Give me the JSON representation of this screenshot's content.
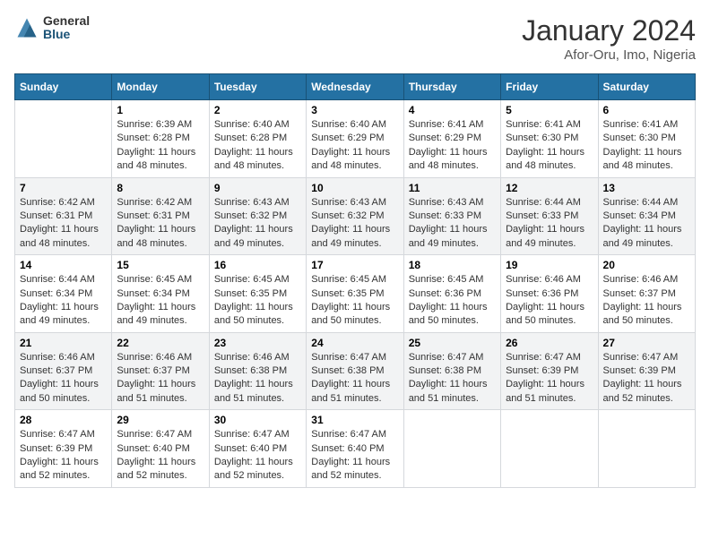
{
  "logo": {
    "general": "General",
    "blue": "Blue"
  },
  "title": "January 2024",
  "subtitle": "Afor-Oru, Imo, Nigeria",
  "days": [
    "Sunday",
    "Monday",
    "Tuesday",
    "Wednesday",
    "Thursday",
    "Friday",
    "Saturday"
  ],
  "weeks": [
    [
      {
        "day": "",
        "content": ""
      },
      {
        "day": "1",
        "content": "Sunrise: 6:39 AM\nSunset: 6:28 PM\nDaylight: 11 hours\nand 48 minutes."
      },
      {
        "day": "2",
        "content": "Sunrise: 6:40 AM\nSunset: 6:28 PM\nDaylight: 11 hours\nand 48 minutes."
      },
      {
        "day": "3",
        "content": "Sunrise: 6:40 AM\nSunset: 6:29 PM\nDaylight: 11 hours\nand 48 minutes."
      },
      {
        "day": "4",
        "content": "Sunrise: 6:41 AM\nSunset: 6:29 PM\nDaylight: 11 hours\nand 48 minutes."
      },
      {
        "day": "5",
        "content": "Sunrise: 6:41 AM\nSunset: 6:30 PM\nDaylight: 11 hours\nand 48 minutes."
      },
      {
        "day": "6",
        "content": "Sunrise: 6:41 AM\nSunset: 6:30 PM\nDaylight: 11 hours\nand 48 minutes."
      }
    ],
    [
      {
        "day": "7",
        "content": "Sunrise: 6:42 AM\nSunset: 6:31 PM\nDaylight: 11 hours\nand 48 minutes."
      },
      {
        "day": "8",
        "content": "Sunrise: 6:42 AM\nSunset: 6:31 PM\nDaylight: 11 hours\nand 48 minutes."
      },
      {
        "day": "9",
        "content": "Sunrise: 6:43 AM\nSunset: 6:32 PM\nDaylight: 11 hours\nand 49 minutes."
      },
      {
        "day": "10",
        "content": "Sunrise: 6:43 AM\nSunset: 6:32 PM\nDaylight: 11 hours\nand 49 minutes."
      },
      {
        "day": "11",
        "content": "Sunrise: 6:43 AM\nSunset: 6:33 PM\nDaylight: 11 hours\nand 49 minutes."
      },
      {
        "day": "12",
        "content": "Sunrise: 6:44 AM\nSunset: 6:33 PM\nDaylight: 11 hours\nand 49 minutes."
      },
      {
        "day": "13",
        "content": "Sunrise: 6:44 AM\nSunset: 6:34 PM\nDaylight: 11 hours\nand 49 minutes."
      }
    ],
    [
      {
        "day": "14",
        "content": "Sunrise: 6:44 AM\nSunset: 6:34 PM\nDaylight: 11 hours\nand 49 minutes."
      },
      {
        "day": "15",
        "content": "Sunrise: 6:45 AM\nSunset: 6:34 PM\nDaylight: 11 hours\nand 49 minutes."
      },
      {
        "day": "16",
        "content": "Sunrise: 6:45 AM\nSunset: 6:35 PM\nDaylight: 11 hours\nand 50 minutes."
      },
      {
        "day": "17",
        "content": "Sunrise: 6:45 AM\nSunset: 6:35 PM\nDaylight: 11 hours\nand 50 minutes."
      },
      {
        "day": "18",
        "content": "Sunrise: 6:45 AM\nSunset: 6:36 PM\nDaylight: 11 hours\nand 50 minutes."
      },
      {
        "day": "19",
        "content": "Sunrise: 6:46 AM\nSunset: 6:36 PM\nDaylight: 11 hours\nand 50 minutes."
      },
      {
        "day": "20",
        "content": "Sunrise: 6:46 AM\nSunset: 6:37 PM\nDaylight: 11 hours\nand 50 minutes."
      }
    ],
    [
      {
        "day": "21",
        "content": "Sunrise: 6:46 AM\nSunset: 6:37 PM\nDaylight: 11 hours\nand 50 minutes."
      },
      {
        "day": "22",
        "content": "Sunrise: 6:46 AM\nSunset: 6:37 PM\nDaylight: 11 hours\nand 51 minutes."
      },
      {
        "day": "23",
        "content": "Sunrise: 6:46 AM\nSunset: 6:38 PM\nDaylight: 11 hours\nand 51 minutes."
      },
      {
        "day": "24",
        "content": "Sunrise: 6:47 AM\nSunset: 6:38 PM\nDaylight: 11 hours\nand 51 minutes."
      },
      {
        "day": "25",
        "content": "Sunrise: 6:47 AM\nSunset: 6:38 PM\nDaylight: 11 hours\nand 51 minutes."
      },
      {
        "day": "26",
        "content": "Sunrise: 6:47 AM\nSunset: 6:39 PM\nDaylight: 11 hours\nand 51 minutes."
      },
      {
        "day": "27",
        "content": "Sunrise: 6:47 AM\nSunset: 6:39 PM\nDaylight: 11 hours\nand 52 minutes."
      }
    ],
    [
      {
        "day": "28",
        "content": "Sunrise: 6:47 AM\nSunset: 6:39 PM\nDaylight: 11 hours\nand 52 minutes."
      },
      {
        "day": "29",
        "content": "Sunrise: 6:47 AM\nSunset: 6:40 PM\nDaylight: 11 hours\nand 52 minutes."
      },
      {
        "day": "30",
        "content": "Sunrise: 6:47 AM\nSunset: 6:40 PM\nDaylight: 11 hours\nand 52 minutes."
      },
      {
        "day": "31",
        "content": "Sunrise: 6:47 AM\nSunset: 6:40 PM\nDaylight: 11 hours\nand 52 minutes."
      },
      {
        "day": "",
        "content": ""
      },
      {
        "day": "",
        "content": ""
      },
      {
        "day": "",
        "content": ""
      }
    ]
  ]
}
